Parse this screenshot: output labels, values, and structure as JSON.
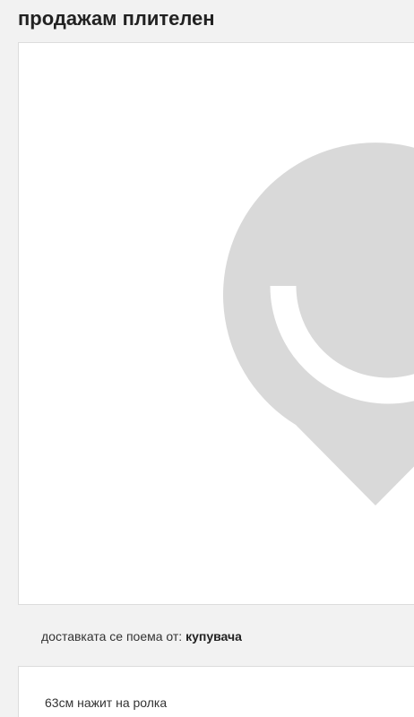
{
  "listing": {
    "title": "продажам плителен",
    "image_icon": "placeholder-pin-icon",
    "placeholder_color": "#d9d9d9"
  },
  "delivery": {
    "label": "доставката се поема от:",
    "value": "купувача"
  },
  "description": {
    "text": "63см нажит на ролка"
  }
}
